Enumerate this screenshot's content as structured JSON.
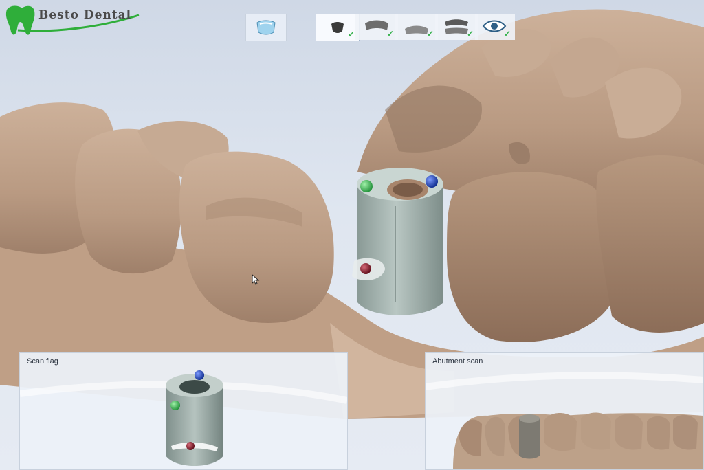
{
  "app": {
    "logo_text": "Besto Dental",
    "brand_color": "#2fae3a"
  },
  "toolbar": {
    "tool_icon": "scan-tray-icon",
    "steps": [
      {
        "icon": "scan-body-icon",
        "completed": true
      },
      {
        "icon": "upper-jaw-icon",
        "completed": true
      },
      {
        "icon": "lower-jaw-icon",
        "completed": true
      },
      {
        "icon": "bite-icon",
        "completed": true
      },
      {
        "icon": "eye-icon",
        "completed": true
      }
    ],
    "check_glyph": "✓",
    "check_color": "#37b24d"
  },
  "panels": {
    "scan_flag": {
      "title": "Scan flag"
    },
    "abutment_scan": {
      "title": "Abutment scan"
    }
  },
  "markers": {
    "green": "#2db34a",
    "blue": "#1a3fb8",
    "red": "#9b1b2a"
  }
}
